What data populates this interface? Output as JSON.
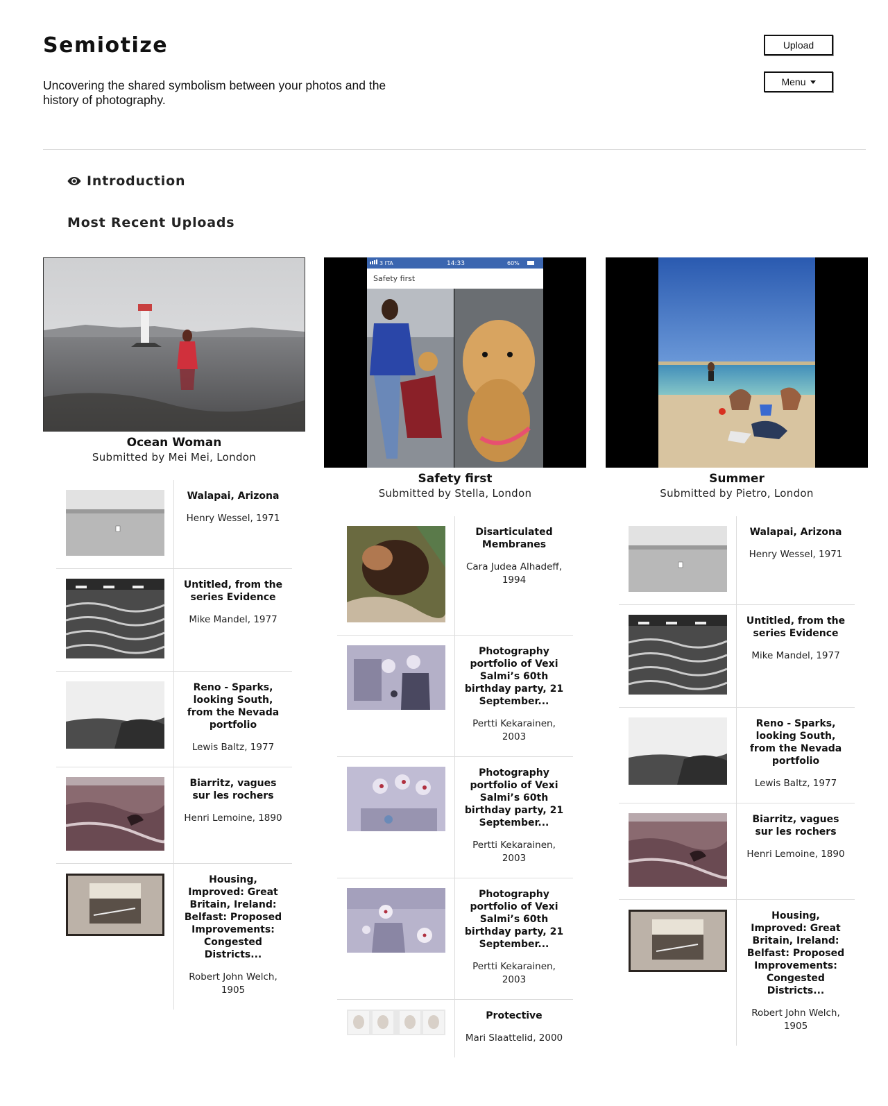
{
  "header": {
    "title": "Semiotize",
    "tagline": "Uncovering the shared symbolism between your photos and the history of photography.",
    "upload_label": "Upload",
    "menu_label": "Menu"
  },
  "nav": {
    "intro_label": "Introduction",
    "intro_icon": "eye-icon"
  },
  "section": {
    "title": "Most Recent Uploads"
  },
  "uploads": [
    {
      "title": "Ocean Woman",
      "submitted": "Submitted by Mei Mei, London",
      "matches": [
        {
          "title": "Walapai, Arizona",
          "credit": "Henry Wessel, 1971"
        },
        {
          "title": "Untitled, from the series Evidence",
          "credit": "Mike Mandel, 1977"
        },
        {
          "title": "Reno - Sparks, looking South, from the Nevada portfolio",
          "credit": "Lewis Baltz, 1977"
        },
        {
          "title": "Biarritz, vagues sur les rochers",
          "credit": "Henri Lemoine, 1890"
        },
        {
          "title": "Housing, Improved: Great Britain, Ireland: Belfast: Proposed Improvements: Congested Districts...",
          "credit": "Robert John Welch, 1905"
        }
      ]
    },
    {
      "title": "Safety first",
      "submitted": "Submitted by Stella, London",
      "phone": {
        "carrier": "3 ITA",
        "time": "14:33",
        "battery": "60%",
        "caption": "Safety first"
      },
      "matches": [
        {
          "title": "Disarticulated Membranes",
          "credit": "Cara Judea Alhadeff, 1994"
        },
        {
          "title": "Photography portfolio of Vexi Salmi’s 60th birthday party, 21 September...",
          "credit": "Pertti Kekarainen, 2003"
        },
        {
          "title": "Photography portfolio of Vexi Salmi’s 60th birthday party, 21 September...",
          "credit": "Pertti Kekarainen, 2003"
        },
        {
          "title": "Photography portfolio of Vexi Salmi’s 60th birthday party, 21 September...",
          "credit": "Pertti Kekarainen, 2003"
        },
        {
          "title": "Protective",
          "credit": "Mari Slaattelid, 2000"
        }
      ]
    },
    {
      "title": "Summer",
      "submitted": "Submitted by Pietro, London",
      "matches": [
        {
          "title": "Walapai, Arizona",
          "credit": "Henry Wessel, 1971"
        },
        {
          "title": "Untitled, from the series Evidence",
          "credit": "Mike Mandel, 1977"
        },
        {
          "title": "Reno - Sparks, looking South, from the Nevada portfolio",
          "credit": "Lewis Baltz, 1977"
        },
        {
          "title": "Biarritz, vagues sur les rochers",
          "credit": "Henri Lemoine, 1890"
        },
        {
          "title": "Housing, Improved: Great Britain, Ireland: Belfast: Proposed Improvements: Congested Districts...",
          "credit": "Robert John Welch, 1905"
        }
      ]
    }
  ]
}
